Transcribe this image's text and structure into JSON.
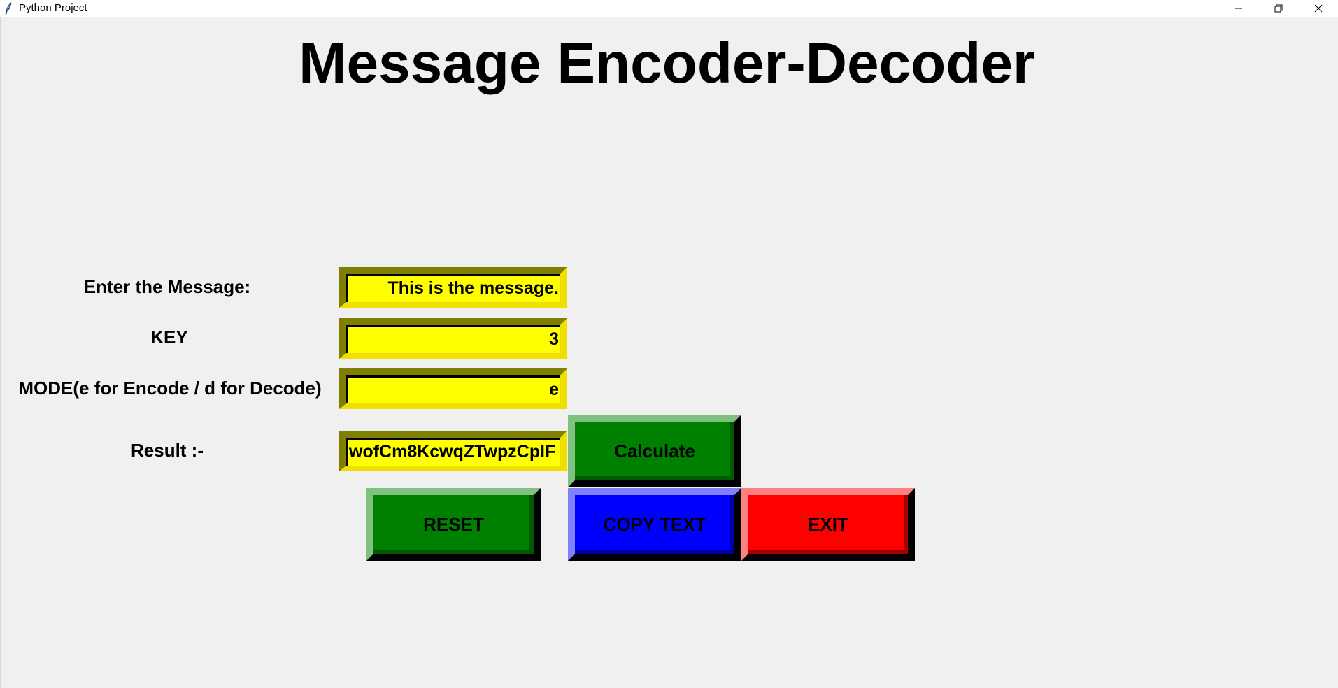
{
  "window": {
    "title": "Python Project",
    "icon": "feather-icon",
    "controls": {
      "minimize": "minimize-icon",
      "restore": "restore-icon",
      "close": "close-icon"
    }
  },
  "app": {
    "heading": "Message Encoder-Decoder",
    "fields": {
      "message": {
        "label": "Enter the Message:",
        "value": "This is the message."
      },
      "key": {
        "label": "KEY",
        "value": "3"
      },
      "mode": {
        "label": "MODE(e for Encode / d for Decode)",
        "value": "e"
      },
      "result": {
        "label": "Result :-",
        "value": "wofCm8KcwqZTwpzCplF"
      }
    },
    "buttons": {
      "calculate": "Calculate",
      "reset": "RESET",
      "copy": "COPY TEXT",
      "exit": "EXIT"
    },
    "colors": {
      "entry_bg": "#ffff00",
      "calculate_bg": "#008000",
      "reset_bg": "#008000",
      "copy_bg": "#0000ff",
      "exit_bg": "#ff0000",
      "window_bg": "#f0f0f0"
    }
  }
}
